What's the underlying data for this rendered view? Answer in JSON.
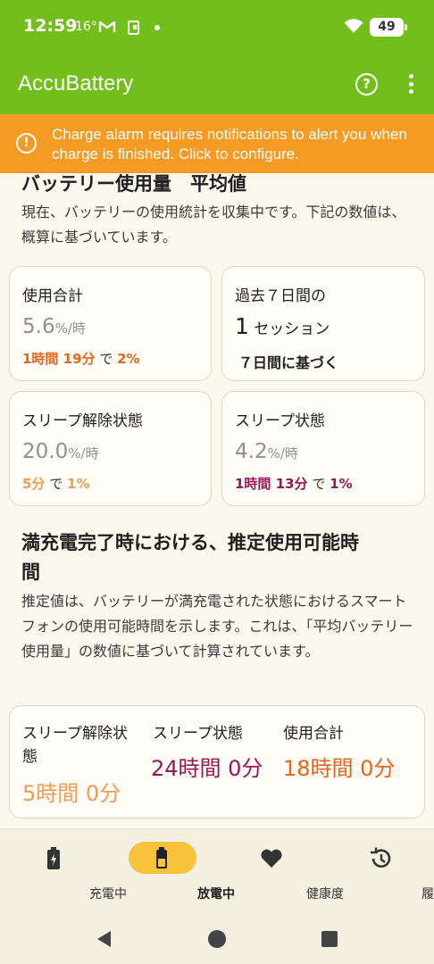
{
  "status_bar": {
    "time": "12:59",
    "temperature": "16°",
    "icons": [
      "gmail-icon",
      "clipboard-icon",
      "dot-icon",
      "wifi-icon"
    ],
    "battery_level": "49"
  },
  "app_bar": {
    "title": "AccuBattery",
    "icons": [
      "help-icon",
      "more-vert-icon"
    ]
  },
  "banner": {
    "icon": "alert-circle-icon",
    "message": "Charge alarm requires notifications to alert you when charge is finished. Click to configure.",
    "color": "#F59A23"
  },
  "average_section": {
    "title": "バッテリー使用量　平均値",
    "description": "現在、バッテリーの使用統計を収集中です。下記の数値は、概算に基づいています。"
  },
  "cards": {
    "total": {
      "label": "使用合計",
      "value": "5.6",
      "unit": "%/時",
      "duration": "1時間 19分",
      "connector": "で",
      "percent": "2%"
    },
    "past7": {
      "label": "過去７日間の",
      "sessions_count": "1",
      "sessions_label": "セッション",
      "basis": "７日間に基づく"
    },
    "awake": {
      "label": "スリープ解除状態",
      "value": "20.0",
      "unit": "%/時",
      "duration": "5分",
      "connector": "で",
      "percent": "1%"
    },
    "sleep": {
      "label": "スリープ状態",
      "value": "4.2",
      "unit": "%/時",
      "duration": "1時間 13分",
      "connector": "で",
      "percent": "1%"
    }
  },
  "estimate_section": {
    "title_line1": "満充電完了時における、推定使用可能時",
    "title_line2": "間",
    "description": "推定値は、バッテリーが満充電された状態におけるスマートフォンの使用可能時間を示します。これは、「平均バッテリー使用量」の数値に基づいて計算されています。"
  },
  "estimate_card": {
    "awake_label_line1": "スリープ解除状",
    "awake_label_line2": "態",
    "awake_value": "5時間 0分",
    "sleep_label": "スリープ状態",
    "sleep_value": "24時間 0分",
    "total_label": "使用合計",
    "total_value": "18時間 0分"
  },
  "bottom_nav": {
    "items": [
      {
        "label": "充電中",
        "icon": "battery-charging-icon"
      },
      {
        "label": "放電中",
        "icon": "battery-discharging-icon"
      },
      {
        "label": "健康度",
        "icon": "heart-icon"
      },
      {
        "label": "履歴",
        "icon": "history-icon"
      }
    ],
    "active_index": 1,
    "active_color": "#F8C23A"
  },
  "colors": {
    "app_green": "#72BE1A",
    "orange": "#E8641B",
    "light_orange": "#F19A56",
    "purple": "#9A1657"
  }
}
